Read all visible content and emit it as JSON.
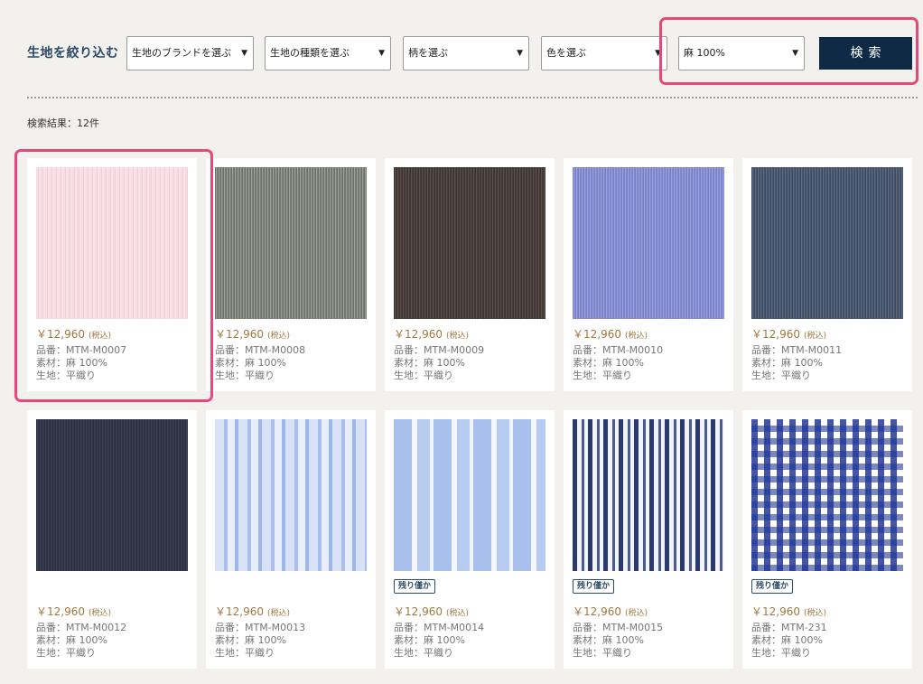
{
  "filters": {
    "label": "生地を絞り込む",
    "selects": [
      {
        "value": "生地のブランドを選ぶ"
      },
      {
        "value": "生地の種類を選ぶ"
      },
      {
        "value": "柄を選ぶ"
      },
      {
        "value": "色を選ぶ"
      },
      {
        "value": "麻 100%"
      }
    ],
    "arrow": "▼",
    "search_label": "検索"
  },
  "results": {
    "count_text": "検索結果：12件"
  },
  "products": [
    {
      "price": "￥12,960",
      "tax": "(税込)",
      "code": "品番：MTM-M0007",
      "material": "素材：麻 100%",
      "weave": "生地：平織り",
      "badge": ""
    },
    {
      "price": "￥12,960",
      "tax": "(税込)",
      "code": "品番：MTM-M0008",
      "material": "素材：麻 100%",
      "weave": "生地：平織り",
      "badge": ""
    },
    {
      "price": "￥12,960",
      "tax": "(税込)",
      "code": "品番：MTM-M0009",
      "material": "素材：麻 100%",
      "weave": "生地：平織り",
      "badge": ""
    },
    {
      "price": "￥12,960",
      "tax": "(税込)",
      "code": "品番：MTM-M0010",
      "material": "素材：麻 100%",
      "weave": "生地：平織り",
      "badge": ""
    },
    {
      "price": "￥12,960",
      "tax": "(税込)",
      "code": "品番：MTM-M0011",
      "material": "素材：麻 100%",
      "weave": "生地：平織り",
      "badge": ""
    },
    {
      "price": "￥12,960",
      "tax": "(税込)",
      "code": "品番：MTM-M0012",
      "material": "素材：麻 100%",
      "weave": "生地：平織り",
      "badge": ""
    },
    {
      "price": "￥12,960",
      "tax": "(税込)",
      "code": "品番：MTM-M0013",
      "material": "素材：麻 100%",
      "weave": "生地：平織り",
      "badge": ""
    },
    {
      "price": "￥12,960",
      "tax": "(税込)",
      "code": "品番：MTM-M0014",
      "material": "素材：麻 100%",
      "weave": "生地：平織り",
      "badge": "残り僅か"
    },
    {
      "price": "￥12,960",
      "tax": "(税込)",
      "code": "品番：MTM-M0015",
      "material": "素材：麻 100%",
      "weave": "生地：平織り",
      "badge": "残り僅か"
    },
    {
      "price": "￥12,960",
      "tax": "(税込)",
      "code": "品番：MTM-231",
      "material": "素材：麻 100%",
      "weave": "生地：平織り",
      "badge": "残り僅か"
    }
  ],
  "colors": {
    "accent_navy": "#0f2a44",
    "price_gold": "#a07840",
    "highlight_pink": "#e8477d"
  }
}
